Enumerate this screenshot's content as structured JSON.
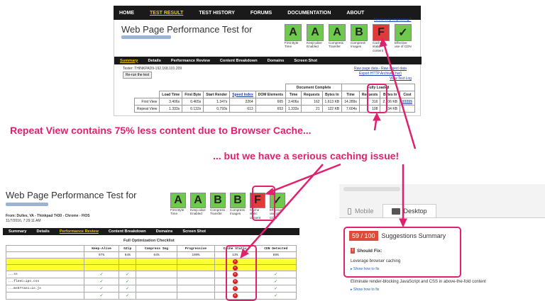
{
  "top_nav": {
    "items": [
      "HOME",
      "TEST RESULT",
      "TEST HISTORY",
      "FORUMS",
      "DOCUMENTATION",
      "ABOUT"
    ],
    "active": "TEST RESULT"
  },
  "top_panel": {
    "title": "Web Page Performance Test for",
    "need_help": "Need help improving?",
    "grades": [
      {
        "letter": "A",
        "label": "First Byte Time",
        "color": "#6fc94e"
      },
      {
        "letter": "A",
        "label": "Keep-alive Enabled",
        "color": "#6fc94e"
      },
      {
        "letter": "A",
        "label": "Compress Transfer",
        "color": "#6fc94e"
      },
      {
        "letter": "B",
        "label": "Compress Images",
        "color": "#6fc94e"
      },
      {
        "letter": "F",
        "label": "Cache static content",
        "color": "#e03b3b"
      },
      {
        "letter": "✓",
        "label": "Effective use of CDN",
        "color": "#6fc94e"
      }
    ],
    "tabs": [
      "Summary",
      "Details",
      "Performance Review",
      "Content Breakdown",
      "Domains",
      "Screen Shot"
    ],
    "tester": "Tester: THINKPAD9-192.168.101.209",
    "rerun": "Re-run the test",
    "raw_links": [
      "Raw page data - Raw object data",
      "Export HTTP Archive (.har)",
      "View Test Log"
    ],
    "table": {
      "group_headers": [
        "Document Complete",
        "Fully Loaded"
      ],
      "headers": [
        "",
        "Load Time",
        "First Byte",
        "Start Render",
        "Speed Index",
        "DOM Elements",
        "Time",
        "Requests",
        "Bytes In",
        "Time",
        "Requests",
        "Bytes In",
        "Cost"
      ],
      "rows": [
        [
          "First View",
          "3.406s",
          "0.465s",
          "1.347s",
          "2264",
          "665",
          "3.406s",
          "162",
          "1,613 KB",
          "14.289s",
          "316",
          "2,106 KB",
          "$$$$$"
        ],
        [
          "Repeat View",
          "1.333s",
          "0.132s",
          "0.793s",
          "613",
          "653",
          "1.333s",
          "21",
          "122 KB",
          "7.604s",
          "108",
          "534 KB",
          ""
        ]
      ]
    }
  },
  "annotations": {
    "repeat_view": "Repeat View contains 75% less content due to Browser Cache...",
    "caching_issue": "... but we have a serious caching issue!"
  },
  "bottom_panel": {
    "title": "Web Page Performance Test for",
    "from_line": "From: Dulles, VA - Thinkpad T430 - Chrome - FIOS",
    "date": "11/7/2016, 7:29:11 AM",
    "tabs": [
      "Summary",
      "Details",
      "Performance Review",
      "Content Breakdown",
      "Domains",
      "Screen Shot"
    ],
    "active_tab": "Performance Review",
    "grades": [
      {
        "letter": "A",
        "label": "First Byte Time",
        "color": "#6fc94e"
      },
      {
        "letter": "A",
        "label": "Keep-alive Enabled",
        "color": "#6fc94e"
      },
      {
        "letter": "B",
        "label": "Compress Transfer",
        "color": "#6fc94e"
      },
      {
        "letter": "B",
        "label": "Compress Images",
        "color": "#6fc94e"
      },
      {
        "letter": "F",
        "label": "Cache static content",
        "color": "#e03b3b"
      },
      {
        "letter": "✓",
        "label": "Effective use of CDN",
        "color": "#6fc94e"
      }
    ],
    "checklist_title": "Full Optimization Checklist",
    "checklist_headers": [
      "",
      "Keep-Alive",
      "GZip",
      "Compress Img",
      "Progressive",
      "Cache Static",
      "CDN Detected"
    ],
    "checklist_subheaders": [
      "",
      "97%",
      "94%",
      "64%",
      "100%",
      "13%",
      "89%"
    ],
    "checklist_rows": [
      {
        "name": "",
        "highlight": true,
        "cells": [
          "",
          "",
          "",
          "",
          "x",
          ""
        ]
      },
      {
        "name": "",
        "highlight": true,
        "cells": [
          "",
          "",
          "",
          "",
          "x",
          ""
        ]
      },
      {
        "name": "...ss",
        "highlight": false,
        "cells": [
          "check",
          "check",
          "",
          "",
          "x",
          "check"
        ]
      },
      {
        "name": "...fleec=ipo.css",
        "highlight": false,
        "cells": [
          "check",
          "check",
          "",
          "",
          "x",
          "check"
        ]
      },
      {
        "name": "...ms5?ranc=io.js",
        "highlight": false,
        "cells": [
          "check",
          "check",
          "",
          "",
          "x",
          "check"
        ]
      },
      {
        "name": "",
        "highlight": false,
        "cells": [
          "check",
          "check",
          "",
          "",
          "x",
          "check"
        ]
      }
    ]
  },
  "pagespeed": {
    "tabs": [
      "Mobile",
      "Desktop"
    ],
    "active_tab": "Desktop",
    "score": "59 / 100",
    "summary_label": "Suggestions Summary",
    "should_fix": "Should Fix:",
    "items": [
      {
        "title": "Leverage browser caching",
        "link": "Show how to fix"
      },
      {
        "title": "Eliminate render-blocking JavaScript and CSS in above-the-fold content",
        "link": "Show how to fix"
      }
    ]
  }
}
